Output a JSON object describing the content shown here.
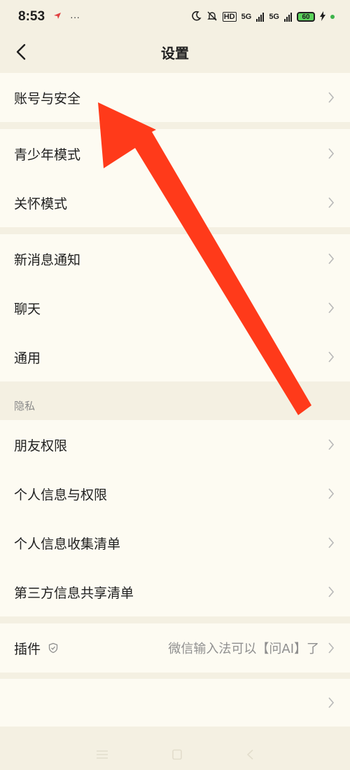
{
  "status": {
    "time": "8:53",
    "dots": "···",
    "hd": "HD",
    "net1": "5G",
    "net2": "5G",
    "battery": "60"
  },
  "header": {
    "title": "设置",
    "back_icon": "chevron-left-icon"
  },
  "groups": [
    {
      "items": [
        {
          "label": "账号与安全"
        }
      ]
    },
    {
      "items": [
        {
          "label": "青少年模式"
        },
        {
          "label": "关怀模式"
        }
      ]
    },
    {
      "items": [
        {
          "label": "新消息通知"
        },
        {
          "label": "聊天"
        },
        {
          "label": "通用"
        }
      ]
    },
    {
      "title": "隐私",
      "items": [
        {
          "label": "朋友权限"
        },
        {
          "label": "个人信息与权限"
        },
        {
          "label": "个人信息收集清单"
        },
        {
          "label": "第三方信息共享清单"
        }
      ]
    },
    {
      "items": [
        {
          "label": "插件",
          "value": "微信输入法可以【问AI】了",
          "icon": "shield-icon"
        }
      ]
    },
    {
      "items": [
        {
          "label": ""
        }
      ]
    }
  ],
  "colors": {
    "accent_arrow": "#ff3a1a",
    "row_bg": "#fdfbf2",
    "page_bg": "#f4f0e2"
  }
}
